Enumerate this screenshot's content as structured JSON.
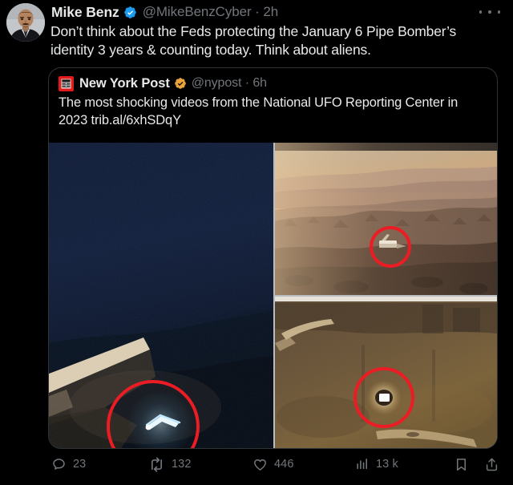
{
  "post": {
    "author": {
      "display_name": "Mike Benz",
      "handle": "@MikeBenzCyber",
      "separator": "·",
      "timestamp": "2h",
      "verified_badge": "verified-blue-badge",
      "avatar": "profile-photo"
    },
    "body_text": "Don’t think about the Feds protecting the January 6 Pipe Bomber’s identity 3 years & counting today. Think about aliens.",
    "more_menu": "more-options"
  },
  "quoted_post": {
    "author": {
      "display_name": "New York Post",
      "handle": "@nypost",
      "separator": "·",
      "timestamp": "6h",
      "verified_badge": "verified-gold-badge",
      "avatar_logo": "new-york-post-logo"
    },
    "body_text": "The most shocking videos from the National UFO Reporting Center in 2023 trib.al/6xhSDqY",
    "media": [
      {
        "position": "left",
        "description": "night sky with boomerang-shaped glowing UFO circled in red above a rooftop",
        "annotation": "red-circle-highlight"
      },
      {
        "position": "top-right",
        "description": "hazy desert canyon landscape at dusk with small bright object circled in red",
        "annotation": "red-circle-highlight"
      },
      {
        "position": "bottom-right",
        "description": "dark sepia scene with bright white glowing orb circled in red",
        "annotation": "red-circle-highlight"
      }
    ]
  },
  "actions": {
    "reply": {
      "icon": "comment-icon",
      "count": "23"
    },
    "repost": {
      "icon": "retweet-icon",
      "count": "132"
    },
    "like": {
      "icon": "heart-icon",
      "count": "446"
    },
    "views": {
      "icon": "analytics-icon",
      "count": "13 k"
    },
    "bookmark": {
      "icon": "bookmark-icon",
      "count": ""
    },
    "share": {
      "icon": "share-icon",
      "count": ""
    }
  },
  "colors": {
    "background": "#000000",
    "text": "#e7e9ea",
    "muted": "#71767b",
    "border": "#2f3336",
    "verified_blue": "#1d9bf0",
    "verified_gold": "#e8a33d",
    "nyp_red": "#e11a1a",
    "annotation_red": "#ec1c24"
  }
}
